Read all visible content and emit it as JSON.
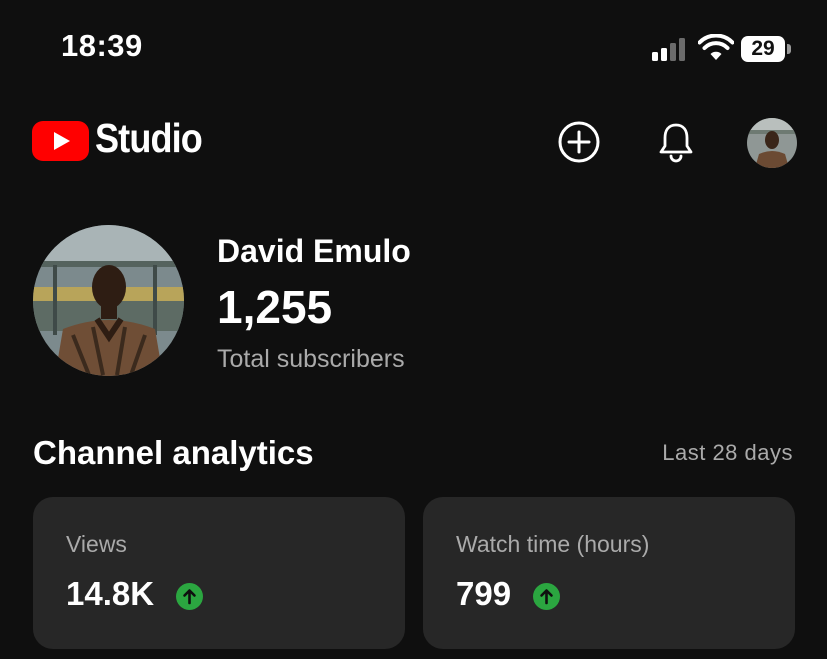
{
  "status_bar": {
    "time": "18:39",
    "battery": "29",
    "icons": [
      "cellular-signal-icon",
      "wifi-icon",
      "battery-icon"
    ]
  },
  "header": {
    "logo_text": "Studio",
    "brand_color": "#ff0000",
    "actions": [
      "create-plus-icon",
      "notifications-bell-icon",
      "profile-avatar"
    ]
  },
  "channel": {
    "name": "David Emulo",
    "subscriber_count": "1,255",
    "subscriber_label": "Total subscribers"
  },
  "analytics": {
    "title": "Channel analytics",
    "period": "Last 28 days",
    "trend_color": "#2ba640",
    "cards": [
      {
        "label": "Views",
        "value": "14.8K",
        "trend": "up"
      },
      {
        "label": "Watch time (hours)",
        "value": "799",
        "trend": "up"
      }
    ]
  }
}
